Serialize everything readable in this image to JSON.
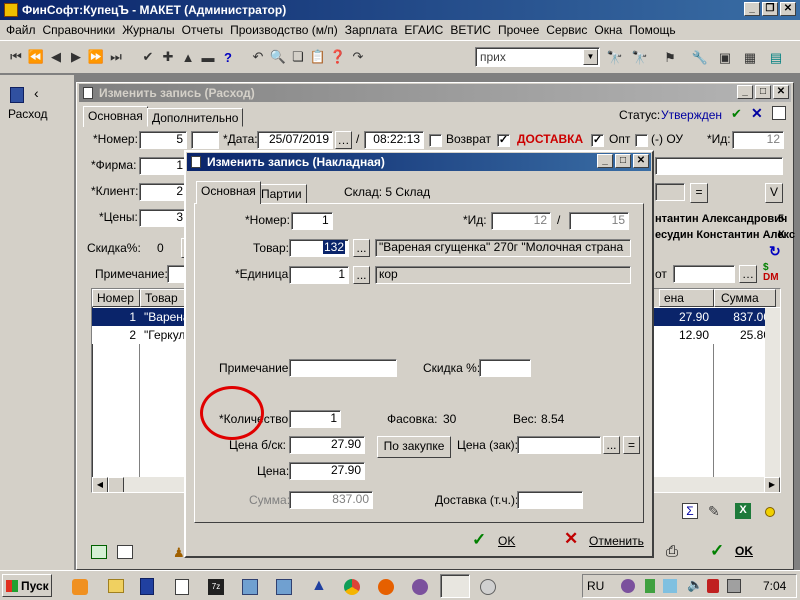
{
  "app": {
    "title": "ФинСофт:КупецЪ - МАКЕТ  (Администратор)"
  },
  "menu": [
    "Файл",
    "Справочники",
    "Журналы",
    "Отчеты",
    "Производство (м/п)",
    "Зарплата",
    "ЕГАИС",
    "ВЕТИС",
    "Прочее",
    "Сервис",
    "Окна",
    "Помощь"
  ],
  "toolbar": {
    "combo_value": "прих"
  },
  "left_panel": {
    "label": "Расход"
  },
  "outer": {
    "title": "Изменить запись (Расход)",
    "tabs": [
      "Основная",
      "Дополнительно"
    ],
    "status_label": "Статус:",
    "status_value": "Утвержден",
    "nomer_label": "*Номер:",
    "nomer_value": "5",
    "data_label": "*Дата:",
    "date_value": "25/07/2019",
    "slash": "/",
    "time_value": "08:22:13",
    "vozvrat_label": "Возврат",
    "dostavka_label": "ДОСТАВКА",
    "opt_label": "Опт",
    "ou_label": "(-) ОУ",
    "id_label": "*Ид:",
    "id_value": "12",
    "firma_label": "*Фирма:",
    "firma_value": "1",
    "client_label": "*Клиент:",
    "client_value": "2",
    "ceny_label": "*Цены:",
    "ceny_value": "3",
    "skidka_label": "Скидка%:",
    "skidka_value": "0",
    "primech_label": "Примечание:",
    "eq": "=",
    "v": "V",
    "person1": "нтантин Александрович",
    "person2": "есудин Константин Алекс",
    "ot_label": "от",
    "num_5": "5",
    "num_k": "К",
    "cols": [
      "Номер",
      "Товар",
      "ена",
      "Сумма"
    ],
    "rows": [
      {
        "n": "1",
        "t": "\"Варена",
        "p": "27.90",
        "s": "837.00"
      },
      {
        "n": "2",
        "t": "\"Геркул",
        "p": "12.90",
        "s": "25.80"
      }
    ],
    "ok_label": "OK"
  },
  "inner": {
    "title": "Изменить запись (Накладная)",
    "tabs": [
      "Основная",
      "Партии"
    ],
    "sklad": "Склад: 5 Склад",
    "nomer_label": "*Номер:",
    "nomer_value": "1",
    "id_label": "*Ид:",
    "id_value": "12",
    "slash": "/",
    "id2_value": "15",
    "tovar_label": "Товар:",
    "tovar_code": "132",
    "tovar_name": "\"Вареная сгущенка\" 270г \"Молочная страна",
    "edin_label": "*Единица:",
    "edin_value": "1",
    "edin_name": "кор",
    "primech_label": "Примечание:",
    "skidka_label": "Скидка %:",
    "kol_label": "*Количество:",
    "kol_value": "1",
    "fasovka_label": "Фасовка:",
    "fasovka_value": "30",
    "ves_label": "Вес:",
    "ves_value": "8.54",
    "cena_bsk_label": "Цена б/ск:",
    "cena_bsk_value": "27.90",
    "po_zakupke": "По закупке",
    "cena_zak_label": "Цена (зак):",
    "cena_label": "Цена:",
    "cena_value": "27.90",
    "summa_label": "Сумма:",
    "summa_value": "837.00",
    "dostavka_label": "Доставка (т.ч.):",
    "ok_label": "OK",
    "cancel_label": "Отменить",
    "dots": "...",
    "eq": "="
  },
  "taskbar": {
    "start": "Пуск",
    "lang": "RU",
    "clock": "7:04"
  },
  "colors": {
    "title_active": "#0a246a",
    "highlight": "#0a246a",
    "dostavka": "#cc0000",
    "annotation": "#e00000"
  }
}
